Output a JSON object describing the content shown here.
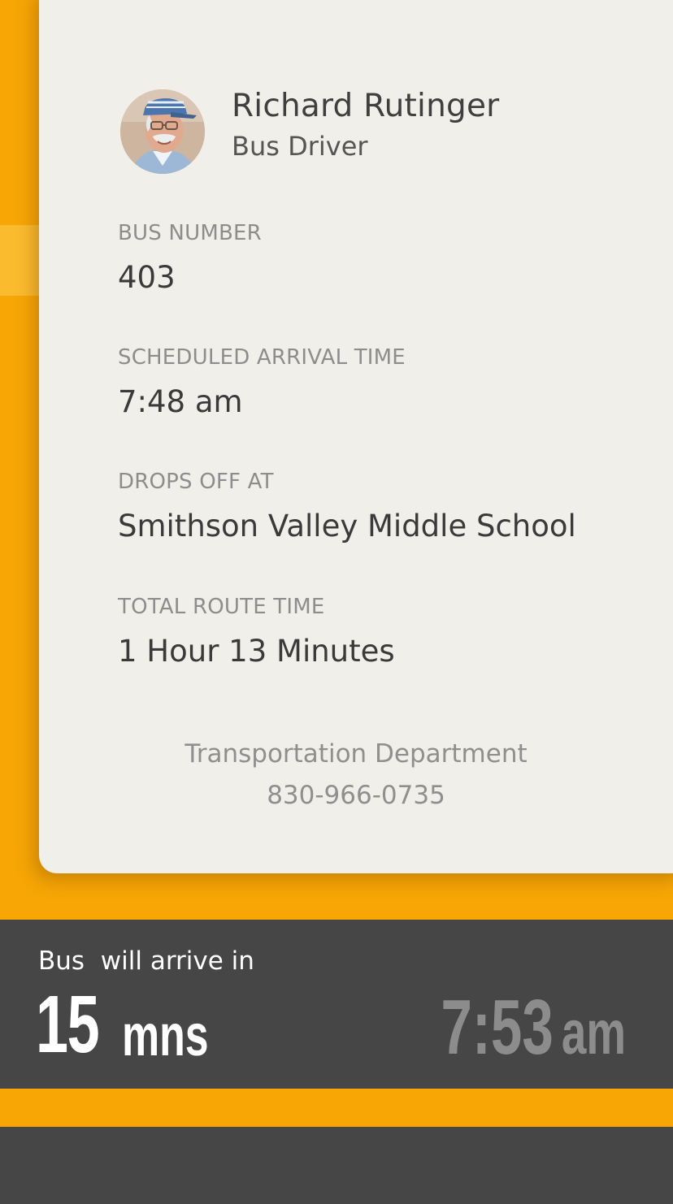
{
  "driver": {
    "name": "Richard Rutinger",
    "role": "Bus Driver"
  },
  "details": {
    "bus_number_label": "BUS NUMBER",
    "bus_number": "403",
    "scheduled_label": "SCHEDULED ARRIVAL TIME",
    "scheduled_time": "7:48 am",
    "drops_off_label": "DROPS OFF AT",
    "drops_off": "Smithson Valley Middle School",
    "route_time_label": "TOTAL ROUTE TIME",
    "route_time": "1 Hour 13 Minutes"
  },
  "contact": {
    "department": "Transportation Department",
    "phone": "830-966-0735"
  },
  "eta": {
    "label": "Bus  will arrive in",
    "minutes": "15",
    "unit": "mns",
    "time": "7:53",
    "ampm": "am"
  },
  "colors": {
    "accent": "#F7A605",
    "card": "#F1EFEA",
    "bar": "#464646"
  },
  "icons": {
    "avatar": "driver-avatar"
  }
}
